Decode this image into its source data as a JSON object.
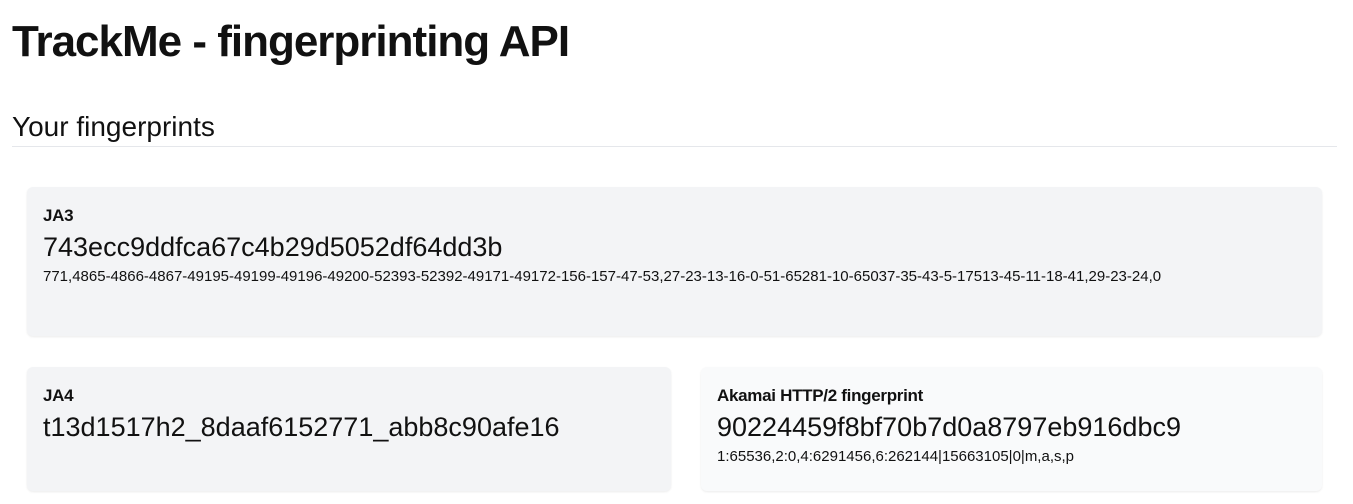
{
  "page": {
    "title": "TrackMe - fingerprinting API",
    "section_title": "Your fingerprints"
  },
  "fingerprints": {
    "ja3": {
      "label": "JA3",
      "hash": "743ecc9ddfca67c4b29d5052df64dd3b",
      "raw": "771,4865-4866-4867-49195-49199-49196-49200-52393-52392-49171-49172-156-157-47-53,27-23-13-16-0-51-65281-10-65037-35-43-5-17513-45-11-18-41,29-23-24,0"
    },
    "ja4": {
      "label": "JA4",
      "hash": "t13d1517h2_8daaf6152771_abb8c90afe16"
    },
    "akamai": {
      "label": "Akamai HTTP/2 fingerprint",
      "hash": "90224459f8bf70b7d0a8797eb916dbc9",
      "raw": "1:65536,2:0,4:6291456,6:262144|15663105|0|m,a,s,p"
    }
  }
}
